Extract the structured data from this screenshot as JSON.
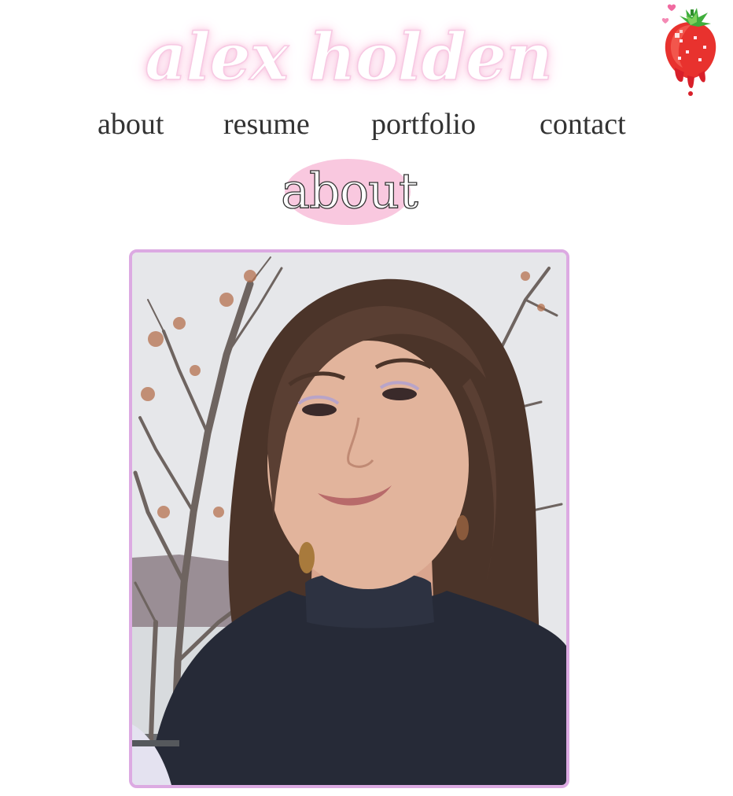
{
  "site": {
    "title": "alex holden",
    "title_glow_color": "#f9c5df",
    "decoration_icon": "strawberry-icon"
  },
  "nav": {
    "items": [
      {
        "id": "about",
        "label": "about"
      },
      {
        "id": "resume",
        "label": "resume"
      },
      {
        "id": "portfolio",
        "label": "portfolio"
      },
      {
        "id": "contact",
        "label": "contact"
      }
    ],
    "text_color": "#333333"
  },
  "section": {
    "heading": "about",
    "heading_highlight_color": "#f9c8df"
  },
  "profile_photo": {
    "frame_color": "#dcaae2",
    "subject": "portrait-photo"
  }
}
